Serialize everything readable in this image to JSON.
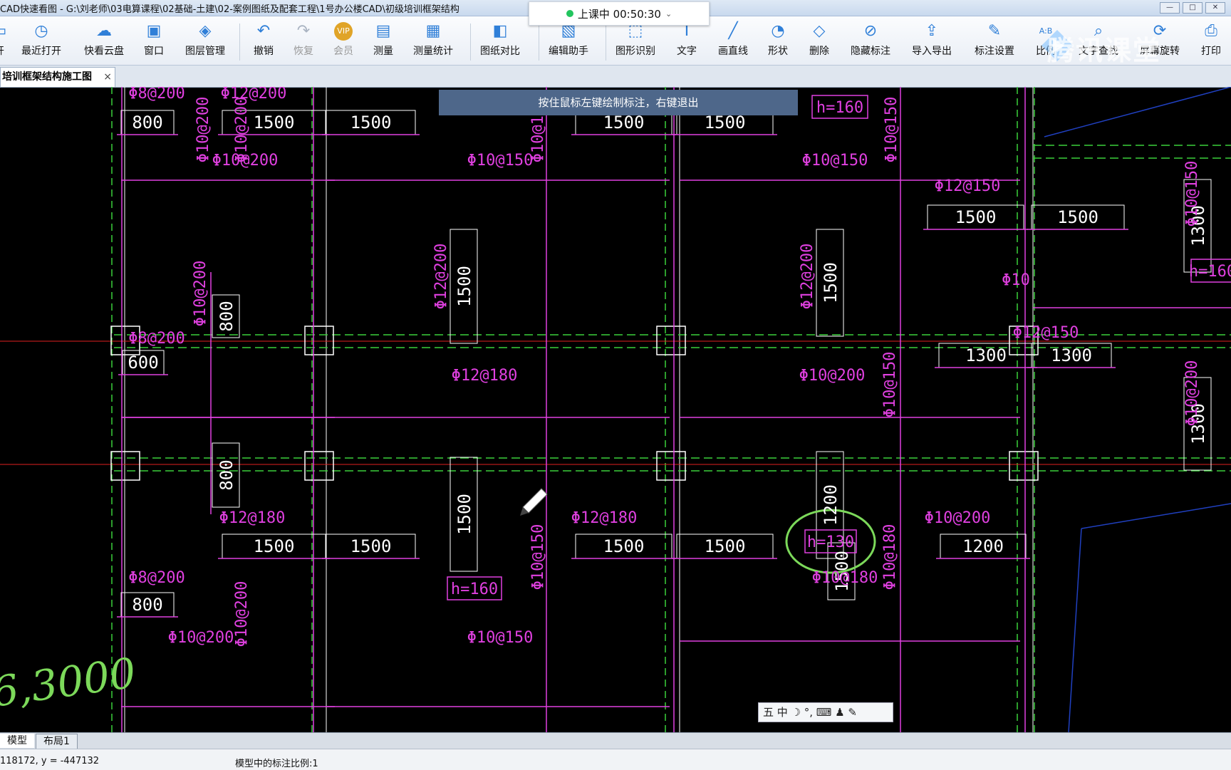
{
  "window": {
    "title": "CAD快速看图 - G:\\刘老师\\03电算课程\\02基础-土建\\02-案例图纸及配套工程\\1号办公楼CAD\\初级培训框架结构",
    "live_status": "上课中 00:50:30",
    "controls": [
      "—",
      "□",
      "✕"
    ]
  },
  "toolbar": {
    "items": [
      {
        "label": "开",
        "icon": "folder-icon"
      },
      {
        "label": "最近打开",
        "icon": "clock-icon"
      },
      {
        "label": "快看云盘",
        "icon": "cloud-icon"
      },
      {
        "label": "窗口",
        "icon": "window-icon"
      },
      {
        "label": "图层管理",
        "icon": "layers-icon"
      },
      {
        "label": "撤销",
        "icon": "undo-icon"
      },
      {
        "label": "恢复",
        "icon": "redo-icon"
      },
      {
        "label": "会员",
        "icon": "vip-icon"
      },
      {
        "label": "测量",
        "icon": "ruler-icon"
      },
      {
        "label": "测量统计",
        "icon": "measure-stats-icon"
      },
      {
        "label": "图纸对比",
        "icon": "compare-icon"
      },
      {
        "label": "编辑助手",
        "icon": "edit-assistant-icon"
      },
      {
        "label": "图形识别",
        "icon": "shape-recognition-icon"
      },
      {
        "label": "文字",
        "icon": "text-icon"
      },
      {
        "label": "画直线",
        "icon": "line-icon"
      },
      {
        "label": "形状",
        "icon": "shape-icon"
      },
      {
        "label": "删除",
        "icon": "eraser-icon"
      },
      {
        "label": "隐藏标注",
        "icon": "hide-annotation-icon"
      },
      {
        "label": "导入导出",
        "icon": "import-export-icon"
      },
      {
        "label": "标注设置",
        "icon": "annotation-settings-icon"
      },
      {
        "label": "比例",
        "icon": "scale-icon"
      },
      {
        "label": "文字查找",
        "icon": "text-search-icon"
      },
      {
        "label": "屏幕旋转",
        "icon": "rotate-screen-icon"
      },
      {
        "label": "打印",
        "icon": "print-icon"
      }
    ],
    "vip_badge": "VIP",
    "scale_badge": "A:B"
  },
  "watermark": "腾讯课堂",
  "tab": {
    "label": "培训框架结构施工图",
    "close": "×"
  },
  "hint": "按住鼠标左键绘制标注，右键退出",
  "drawing": {
    "spans": [
      "800",
      "1500",
      "1500",
      "1500",
      "1500",
      "1500",
      "1500",
      "1500",
      "1300",
      "1300",
      "600",
      "800",
      "800",
      "1500",
      "1500",
      "1500",
      "1500",
      "1500",
      "1500",
      "1200",
      "1200",
      "1300",
      "1300",
      "1500"
    ],
    "rebar": [
      "Φ8@200",
      "Φ12@200",
      "Φ10@200",
      "Φ10@200",
      "Φ10@150",
      "Φ10@150",
      "Φ12@150",
      "Φ12@200",
      "Φ12@200",
      "Φ10@200",
      "Φ8@200",
      "Φ10@200",
      "Φ10@200",
      "Φ12@150",
      "Φ10@150",
      "Φ12@180",
      "Φ12@180",
      "Φ10@200",
      "Φ10@180",
      "Φ10@180",
      "Φ8@200",
      "Φ10@200",
      "Φ10@200",
      "Φ10@150",
      "Φ10@150",
      "Φ10@200",
      "Φ10@150",
      "Φ10@150",
      "Φ10@200",
      "Φ10"
    ],
    "heights": [
      "h=160",
      "h=160",
      "h=130",
      "h=160"
    ],
    "handwriting": "6,3000"
  },
  "ime": {
    "label": "五 中 ☽ °, ⌨ ♟ ✎"
  },
  "bottom_tabs": {
    "model": "模型",
    "layout": "布局1"
  },
  "status": {
    "coords": "118172, y = -447132",
    "scale": "模型中的标注比例:1"
  }
}
